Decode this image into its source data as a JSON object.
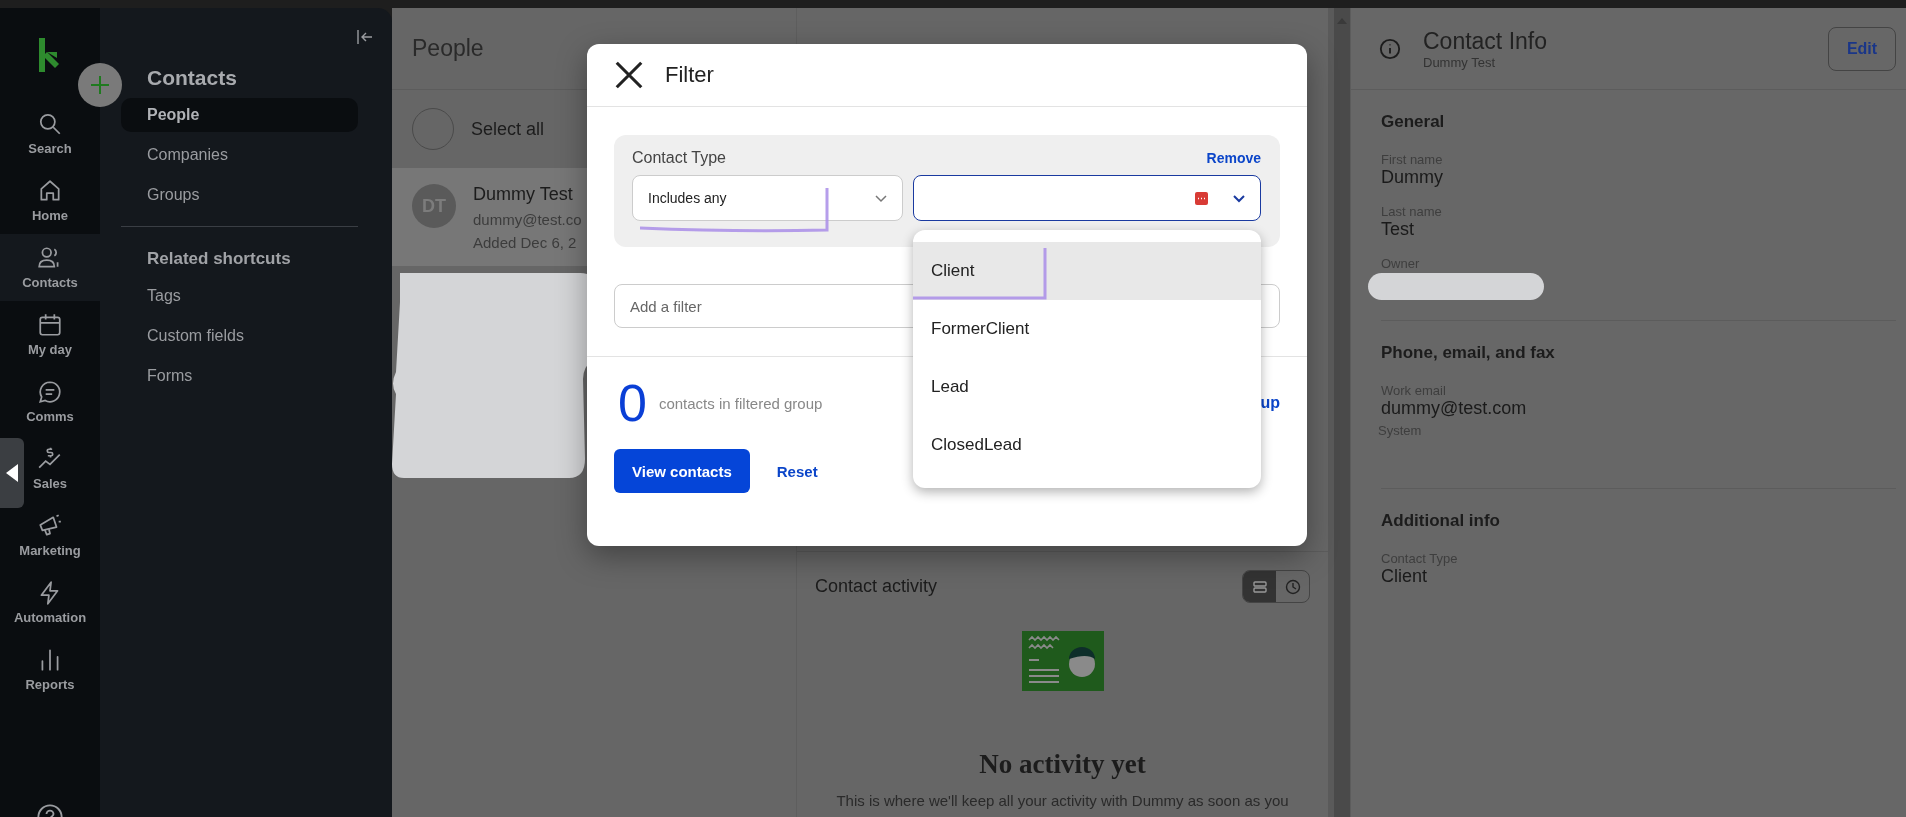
{
  "rail": {
    "items": [
      {
        "label": "Search",
        "selected": false
      },
      {
        "label": "Home",
        "selected": false
      },
      {
        "label": "Contacts",
        "selected": true
      },
      {
        "label": "My day",
        "selected": false
      },
      {
        "label": "Comms",
        "selected": false
      },
      {
        "label": "Sales",
        "selected": false
      },
      {
        "label": "Marketing",
        "selected": false
      },
      {
        "label": "Automation",
        "selected": false
      },
      {
        "label": "Reports",
        "selected": false
      }
    ]
  },
  "sidebar": {
    "title": "Contacts",
    "items": [
      {
        "label": "People",
        "selected": true
      },
      {
        "label": "Companies",
        "selected": false
      },
      {
        "label": "Groups",
        "selected": false
      }
    ],
    "section_title": "Related shortcuts",
    "shortcuts": [
      "Tags",
      "Custom fields",
      "Forms"
    ]
  },
  "people": {
    "title": "People",
    "select_all": {
      "label": "Select all",
      "checked": false
    },
    "contacts": [
      {
        "initials": "DT",
        "name": "Dummy Test",
        "email": "dummy@test.co",
        "added": "Added Dec 6, 2",
        "selected": true
      }
    ]
  },
  "filter_dialog": {
    "title": "Filter",
    "group": {
      "label": "Contact Type",
      "remove": "Remove",
      "operator": "Includes any"
    },
    "options": [
      {
        "label": "Client",
        "selected": true
      },
      {
        "label": "FormerClient",
        "selected": false
      },
      {
        "label": "Lead",
        "selected": false
      },
      {
        "label": "ClosedLead",
        "selected": false
      }
    ],
    "add_filter_placeholder": "Add a filter",
    "count": "0",
    "count_label": "contacts in filtered group",
    "group_link": "up",
    "primary_button": "View contacts",
    "reset": "Reset"
  },
  "activity": {
    "title": "Contact activity",
    "views": [
      {
        "selected": true
      },
      {
        "selected": false
      }
    ],
    "empty_title": "No activity yet",
    "empty_text": "This is where we'll keep all your activity with Dummy as soon as you"
  },
  "contact_info": {
    "title": "Contact Info",
    "subtitle": "Dummy Test",
    "edit": "Edit",
    "sections": [
      {
        "title": "General",
        "fields": [
          {
            "kind": "text",
            "label": "First name",
            "value": "Dummy"
          },
          {
            "kind": "text",
            "label": "Last name",
            "value": "Test"
          },
          {
            "kind": "redacted",
            "label": "Owner"
          }
        ]
      },
      {
        "title": "Phone, email, and fax",
        "fields": [
          {
            "kind": "text",
            "label": "Work email",
            "value": "dummy@test.com",
            "note": "System"
          }
        ]
      },
      {
        "title": "Additional info",
        "fields": [
          {
            "kind": "text",
            "label": "Contact Type",
            "value": "Client"
          }
        ]
      }
    ]
  }
}
